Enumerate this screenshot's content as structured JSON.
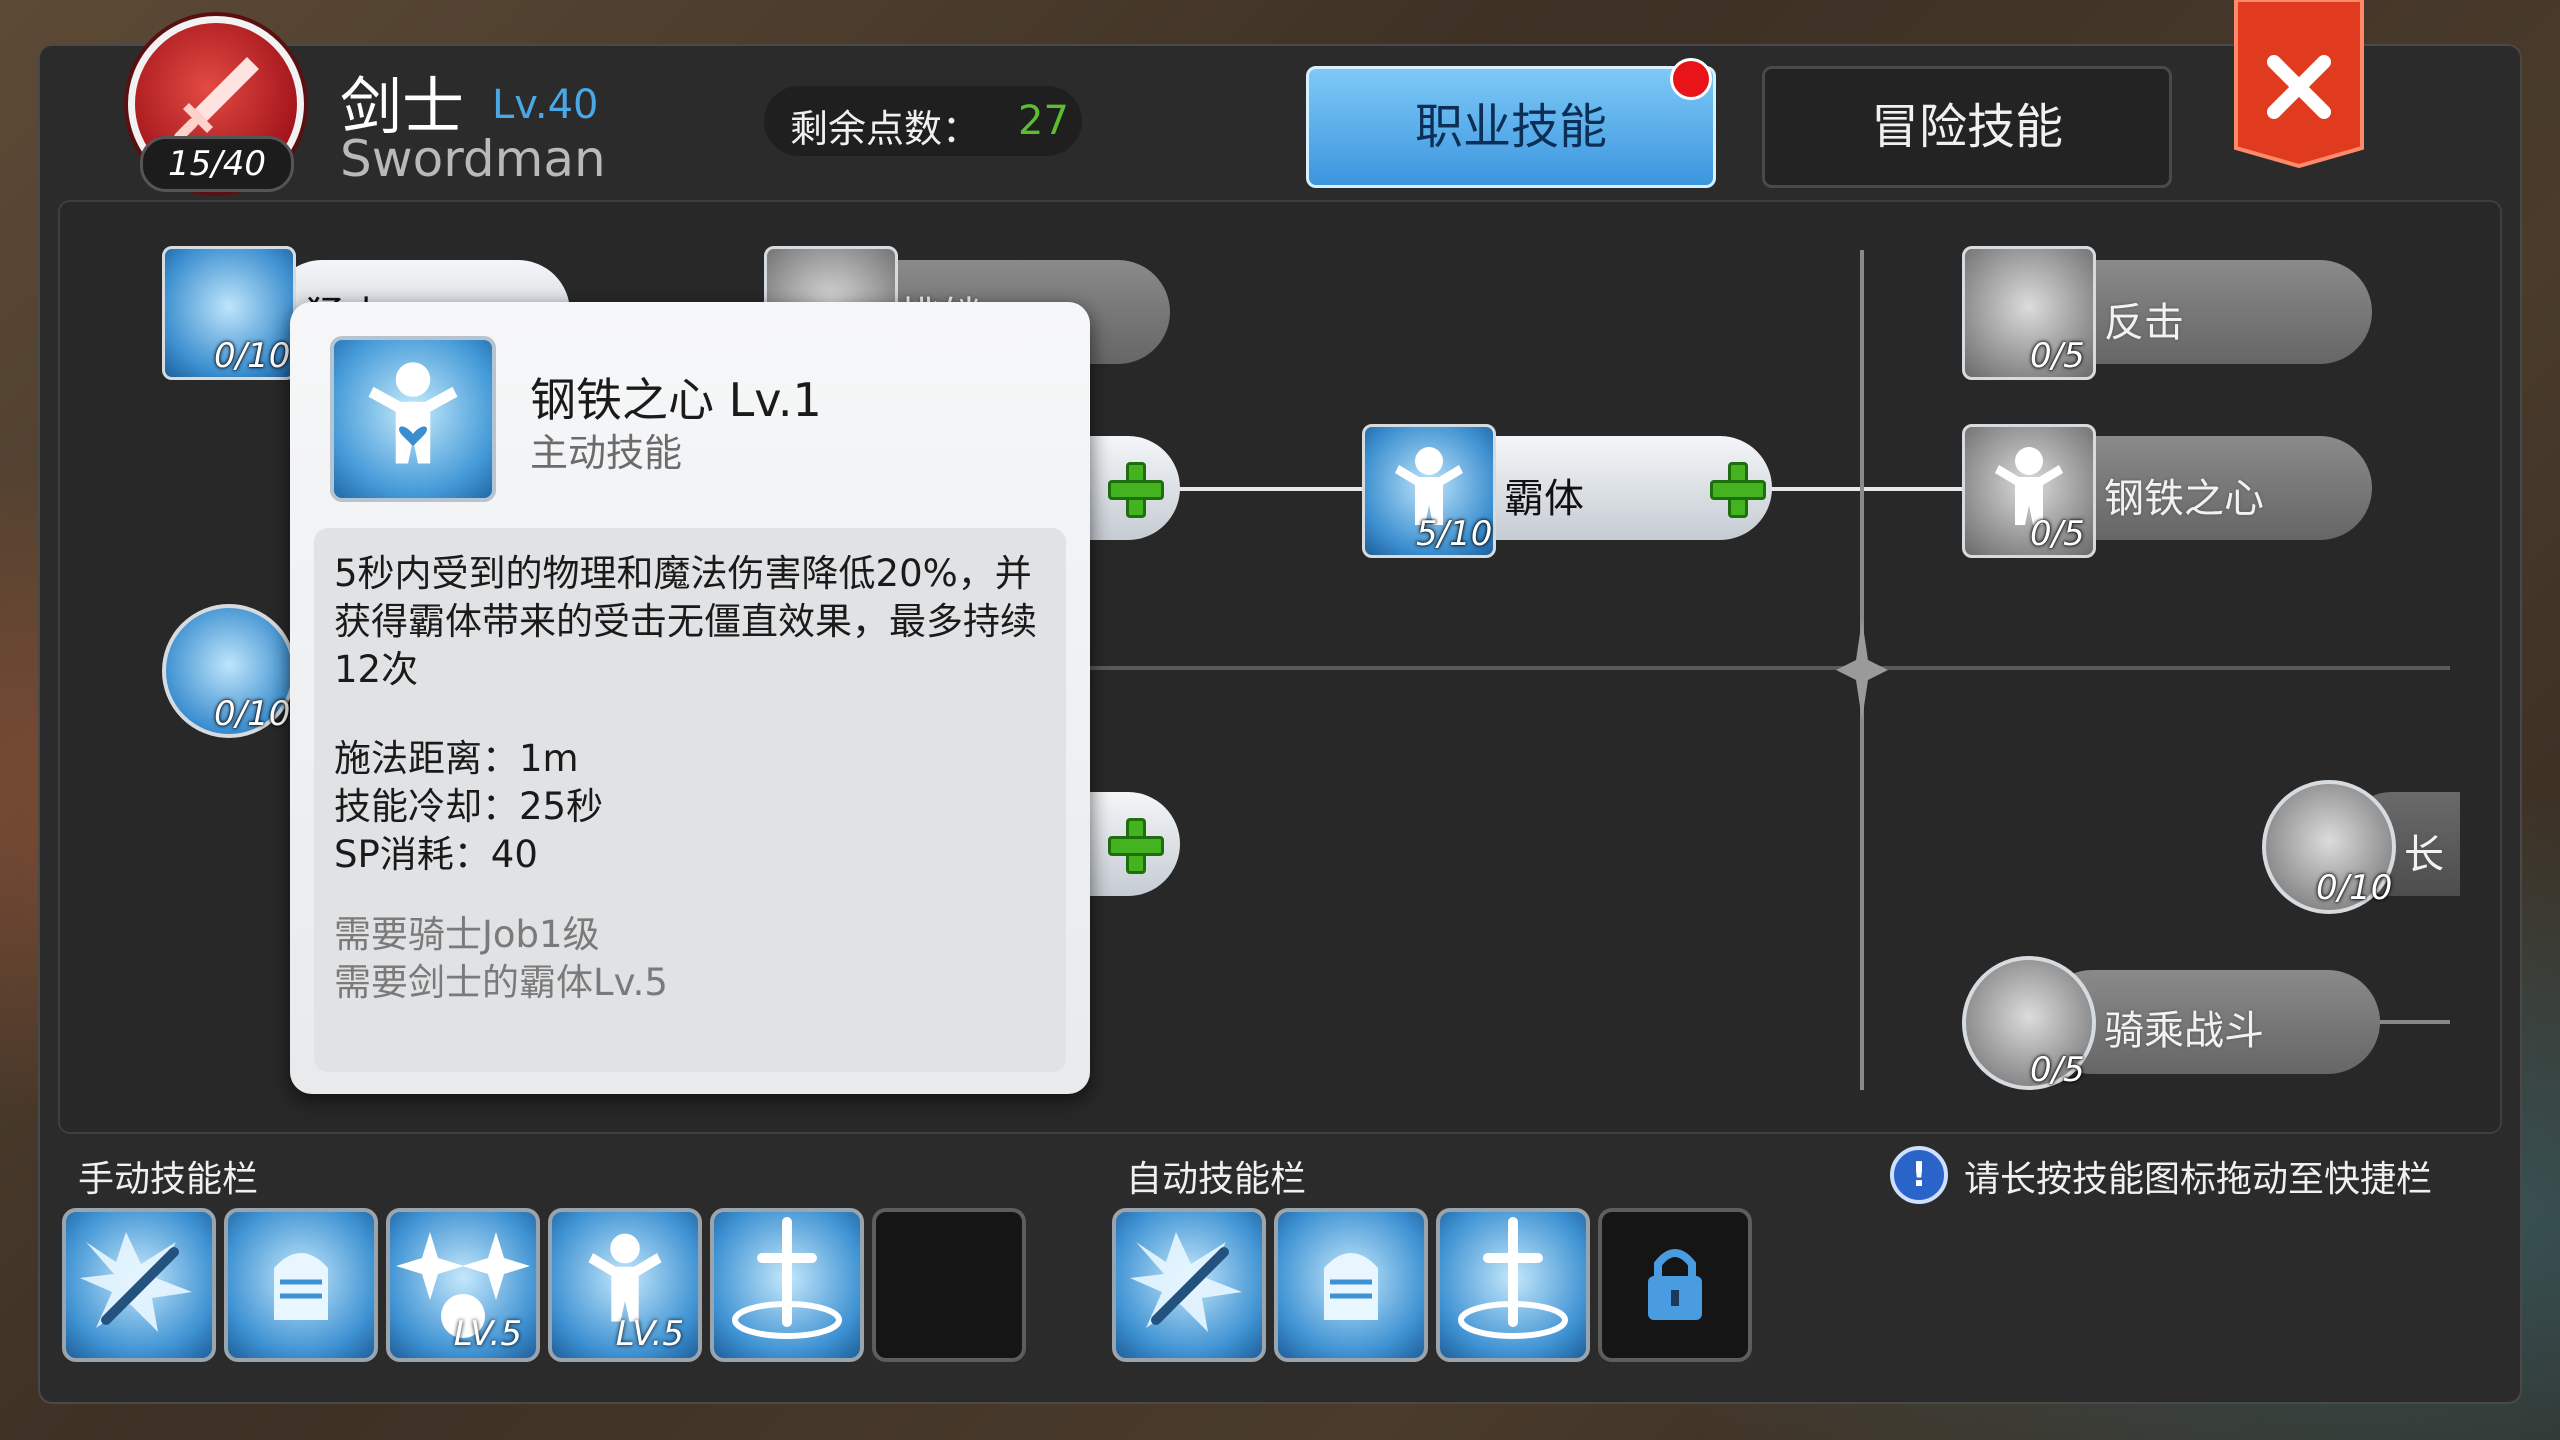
{
  "header": {
    "class_name": "剑士",
    "class_level": "Lv.40",
    "class_name_en": "Swordman",
    "class_points": "15/40",
    "remaining_points_label": "剩余点数：",
    "remaining_points_value": "27",
    "tabs": [
      {
        "label": "职业技能",
        "selected": true,
        "has_notification": true
      },
      {
        "label": "冒险技能",
        "selected": false
      }
    ]
  },
  "skill_tree": {
    "nodes": [
      {
        "id": "left-top",
        "label": "猛击",
        "count": "0/10"
      },
      {
        "id": "top-mid",
        "label": "挑衅",
        "count": ""
      },
      {
        "id": "baton",
        "label": "霸体",
        "count": "5/10"
      },
      {
        "id": "counter",
        "label": "反击",
        "count": "0/5"
      },
      {
        "id": "iron-heart",
        "label": "钢铁之心",
        "count": "0/5"
      },
      {
        "id": "left-mid",
        "label": "",
        "count": "0/10"
      },
      {
        "id": "spear",
        "label": "长",
        "count": "0/10"
      },
      {
        "id": "mount",
        "label": "骑乘战斗",
        "count": "0/5"
      }
    ]
  },
  "tooltip": {
    "name": "钢铁之心  Lv.1",
    "type": "主动技能",
    "description": "5秒内受到的物理和魔法伤害降低20%，并获得霸体带来的受击无僵直效果，最多持续12次",
    "range": "施法距离：1m",
    "cooldown": "技能冷却：25秒",
    "sp_cost": "SP消耗：40",
    "req_1": "需要骑士Job1级",
    "req_2": "需要剑士的霸体Lv.5"
  },
  "manual_bar": {
    "label": "手动技能栏",
    "slots": [
      {
        "icon": "bash-icon",
        "level": ""
      },
      {
        "icon": "fist-icon",
        "level": ""
      },
      {
        "icon": "sparkle-icon",
        "level": "LV.5"
      },
      {
        "icon": "endure-icon",
        "level": "LV.5"
      },
      {
        "icon": "sword-aura-icon",
        "level": ""
      },
      {
        "icon": "",
        "level": ""
      }
    ]
  },
  "auto_bar": {
    "label": "自动技能栏",
    "slots": [
      {
        "icon": "bash-icon"
      },
      {
        "icon": "fist-icon"
      },
      {
        "icon": "sword-aura-icon"
      },
      {
        "icon": "lock-icon"
      }
    ]
  },
  "hint": {
    "text": "请长按技能图标拖动至快捷栏"
  },
  "colors": {
    "accent_blue": "#3b96de",
    "points_green": "#5cbd2f",
    "close_red": "#e03a1f",
    "plus_green": "#43b320"
  }
}
